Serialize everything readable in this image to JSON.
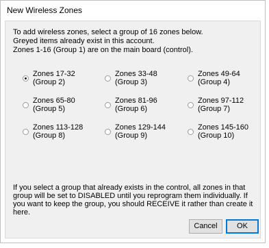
{
  "window": {
    "title": "New Wireless Zones"
  },
  "intro": {
    "lines": [
      "To add wireless zones, select a group of 16 zones below.",
      "Greyed items already exist in this account.",
      "Zones 1-16 (Group 1) are on the main board (control)."
    ]
  },
  "groups": [
    {
      "zones": "Zones 17-32",
      "group": "(Group 2)",
      "checked": true
    },
    {
      "zones": "Zones 33-48",
      "group": "(Group 3)",
      "checked": false
    },
    {
      "zones": "Zones 49-64",
      "group": "(Group 4)",
      "checked": false
    },
    {
      "zones": "Zones 65-80",
      "group": "(Group 5)",
      "checked": false
    },
    {
      "zones": "Zones 81-96",
      "group": "(Group 6)",
      "checked": false
    },
    {
      "zones": "Zones 97-112",
      "group": "(Group 7)",
      "checked": false
    },
    {
      "zones": "Zones 113-128",
      "group": "(Group 8)",
      "checked": false
    },
    {
      "zones": "Zones 129-144",
      "group": "(Group 9)",
      "checked": false
    },
    {
      "zones": "Zones 145-160",
      "group": "(Group 10)",
      "checked": false
    }
  ],
  "warning": {
    "lines": [
      "If you select a group that already exists in the control, all zones in that",
      "group will be set to DISABLED until you reprogram them individually.  If",
      "you want to keep the group, you should RECEIVE it rather than create it",
      "here."
    ]
  },
  "buttons": {
    "cancel": "Cancel",
    "ok": "OK"
  }
}
